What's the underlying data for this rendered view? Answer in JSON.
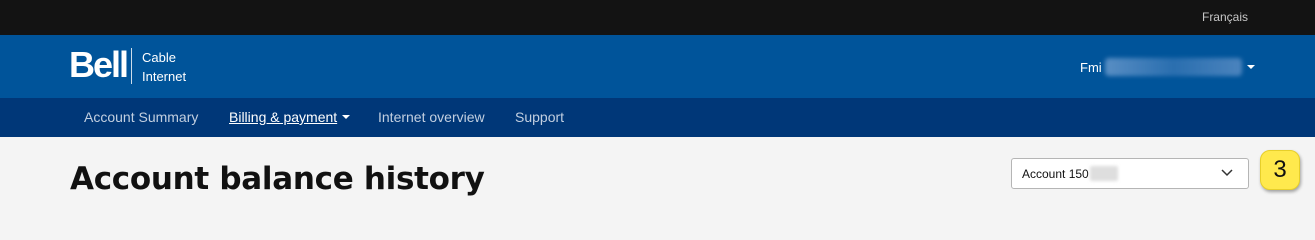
{
  "topbar": {
    "language_link": "Français"
  },
  "header": {
    "logo": "Bell",
    "product_line1": "Cable",
    "product_line2": "Internet",
    "user_name_visible": "Fmi"
  },
  "nav": {
    "items": [
      {
        "label": "Account Summary"
      },
      {
        "label": "Billing & payment"
      },
      {
        "label": "Internet overview"
      },
      {
        "label": "Support"
      }
    ]
  },
  "page": {
    "title": "Account balance history",
    "account_select": {
      "label": "Account 150"
    },
    "step_badge": "3"
  },
  "colors": {
    "topbar": "#131313",
    "header": "#00549a",
    "nav": "#003778",
    "badge": "#ffe94d",
    "background": "#f4f4f4"
  }
}
